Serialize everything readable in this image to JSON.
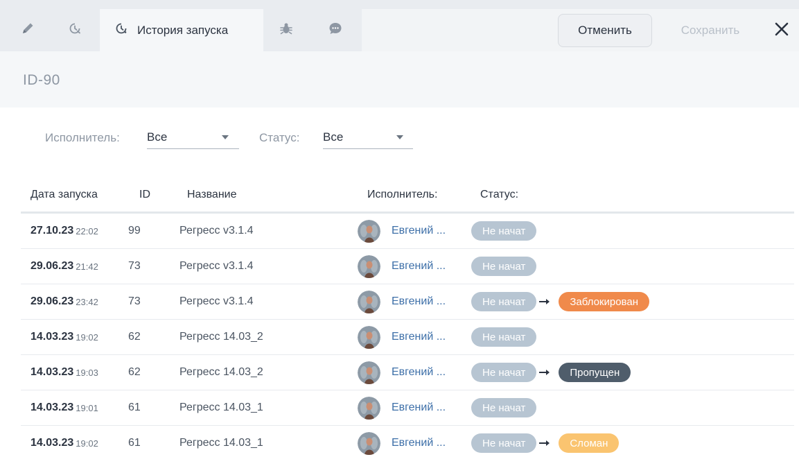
{
  "tabs": [
    {
      "id": "edit",
      "icon": "pencil-icon",
      "label": ""
    },
    {
      "id": "history",
      "icon": "history-icon",
      "label": ""
    },
    {
      "id": "launch-history",
      "icon": "history-icon",
      "label": "История запуска",
      "active": true
    },
    {
      "id": "bugs",
      "icon": "bug-icon",
      "label": ""
    },
    {
      "id": "comments",
      "icon": "chat-icon",
      "label": ""
    }
  ],
  "toolbar": {
    "cancel_label": "Отменить",
    "save_label": "Сохранить",
    "close_icon": "close-icon"
  },
  "header": {
    "item_id": "ID-90"
  },
  "filters": {
    "assignee": {
      "label": "Исполнитель:",
      "value": "Все"
    },
    "status": {
      "label": "Статус:",
      "value": "Все"
    }
  },
  "table": {
    "columns": [
      "Дата запуска",
      "ID",
      "Название",
      "Исполнитель:",
      "Статус:"
    ],
    "rows": [
      {
        "date": "27.10.23",
        "time": "22:02",
        "id": "99",
        "name": "Регресс v3.1.4",
        "user": "Евгений ...",
        "status_from": "Не начат",
        "status_to": "",
        "status_to_kind": ""
      },
      {
        "date": "29.06.23",
        "time": "21:42",
        "id": "73",
        "name": "Регресс v3.1.4",
        "user": "Евгений ...",
        "status_from": "Не начат",
        "status_to": "",
        "status_to_kind": ""
      },
      {
        "date": "29.06.23",
        "time": "23:42",
        "id": "73",
        "name": "Регресс v3.1.4",
        "user": "Евгений ...",
        "status_from": "Не начат",
        "status_to": "Заблокирован",
        "status_to_kind": "blocked"
      },
      {
        "date": "14.03.23",
        "time": "19:02",
        "id": "62",
        "name": "Регресс 14.03_2",
        "user": "Евгений ...",
        "status_from": "Не начат",
        "status_to": "",
        "status_to_kind": ""
      },
      {
        "date": "14.03.23",
        "time": "19:03",
        "id": "62",
        "name": "Регресс 14.03_2",
        "user": "Евгений ...",
        "status_from": "Не начат",
        "status_to": "Пропущен",
        "status_to_kind": "skipped"
      },
      {
        "date": "14.03.23",
        "time": "19:01",
        "id": "61",
        "name": "Регресс 14.03_1",
        "user": "Евгений ...",
        "status_from": "Не начат",
        "status_to": "",
        "status_to_kind": ""
      },
      {
        "date": "14.03.23",
        "time": "19:02",
        "id": "61",
        "name": "Регресс 14.03_1",
        "user": "Евгений ...",
        "status_from": "Не начат",
        "status_to": "Сломан",
        "status_to_kind": "broken"
      }
    ]
  },
  "colors": {
    "blocked": "#f08a4b",
    "skipped": "#4f5d6b",
    "broken": "#fac470",
    "not_started": "#b7c5d2",
    "user_link": "#3d6fa8"
  }
}
